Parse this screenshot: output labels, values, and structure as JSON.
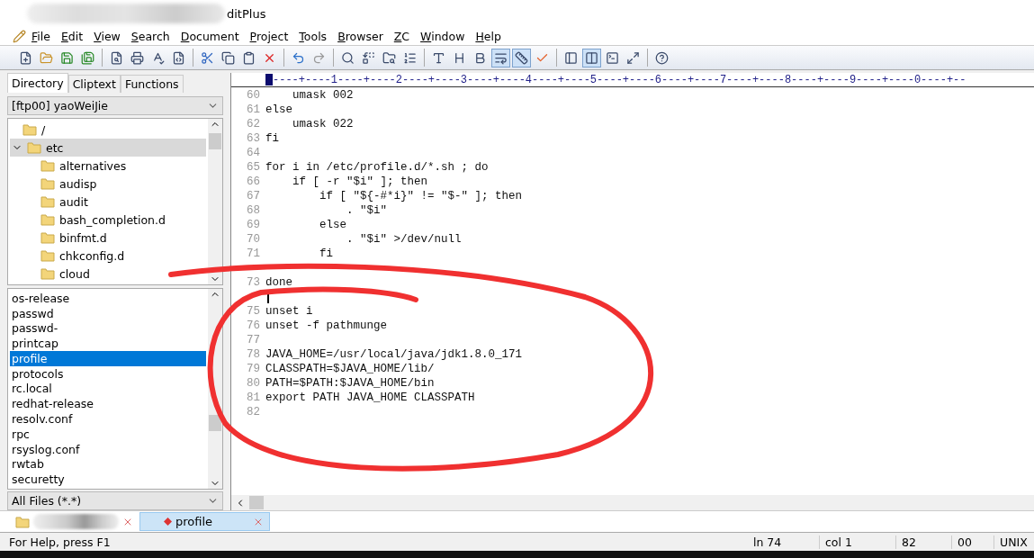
{
  "window": {
    "title": "ditPlus"
  },
  "menu": [
    {
      "label": "File"
    },
    {
      "label": "Edit"
    },
    {
      "label": "View"
    },
    {
      "label": "Search"
    },
    {
      "label": "Document"
    },
    {
      "label": "Project"
    },
    {
      "label": "Tools"
    },
    {
      "label": "Browser"
    },
    {
      "label": "ZC"
    },
    {
      "label": "Window"
    },
    {
      "label": "Help"
    }
  ],
  "toolbar": [
    {
      "kind": "new",
      "pressed": false
    },
    {
      "kind": "open",
      "pressed": false
    },
    {
      "kind": "save",
      "pressed": false
    },
    {
      "kind": "saveall",
      "pressed": false
    },
    {
      "kind": "sep"
    },
    {
      "kind": "preview",
      "pressed": false
    },
    {
      "kind": "print",
      "pressed": false
    },
    {
      "kind": "spell",
      "pressed": false
    },
    {
      "kind": "html",
      "pressed": false
    },
    {
      "kind": "sep"
    },
    {
      "kind": "cut",
      "pressed": false
    },
    {
      "kind": "copy",
      "pressed": false
    },
    {
      "kind": "paste",
      "pressed": false
    },
    {
      "kind": "delete",
      "pressed": false
    },
    {
      "kind": "sep"
    },
    {
      "kind": "undo",
      "pressed": false
    },
    {
      "kind": "redo",
      "pressed": false
    },
    {
      "kind": "sep"
    },
    {
      "kind": "find",
      "pressed": false
    },
    {
      "kind": "replace",
      "pressed": false
    },
    {
      "kind": "findfiles",
      "pressed": false
    },
    {
      "kind": "goto",
      "pressed": false
    },
    {
      "kind": "sep"
    },
    {
      "kind": "font",
      "pressed": false
    },
    {
      "kind": "heading",
      "pressed": false
    },
    {
      "kind": "bold",
      "pressed": false
    },
    {
      "kind": "wrap",
      "pressed": true
    },
    {
      "kind": "ruler",
      "pressed": true
    },
    {
      "kind": "check",
      "pressed": false
    },
    {
      "kind": "sep"
    },
    {
      "kind": "panel",
      "pressed": false
    },
    {
      "kind": "split",
      "pressed": true
    },
    {
      "kind": "output",
      "pressed": false
    },
    {
      "kind": "fullscreen",
      "pressed": false
    },
    {
      "kind": "sep"
    },
    {
      "kind": "help",
      "pressed": false
    }
  ],
  "side_tabs": [
    {
      "label": "Directory",
      "selected": true
    },
    {
      "label": "Cliptext",
      "selected": false
    },
    {
      "label": "Functions",
      "selected": false
    }
  ],
  "location": {
    "value": "[ftp00] yaoWeiJie"
  },
  "tree": [
    {
      "label": "/",
      "selected": false
    },
    {
      "label": "etc",
      "selected": true,
      "expanded": true,
      "children": [
        {
          "label": "alternatives",
          "selected": false
        },
        {
          "label": "audisp",
          "selected": false
        },
        {
          "label": "audit",
          "selected": false
        },
        {
          "label": "bash_completion.d",
          "selected": false
        },
        {
          "label": "binfmt.d",
          "selected": false
        },
        {
          "label": "chkconfig.d",
          "selected": false
        },
        {
          "label": "cloud",
          "selected": false
        }
      ]
    }
  ],
  "files": [
    {
      "label": "os-release",
      "selected": false
    },
    {
      "label": "passwd",
      "selected": false
    },
    {
      "label": "passwd-",
      "selected": false
    },
    {
      "label": "printcap",
      "selected": false
    },
    {
      "label": "profile",
      "selected": true
    },
    {
      "label": "protocols",
      "selected": false
    },
    {
      "label": "rc.local",
      "selected": false
    },
    {
      "label": "redhat-release",
      "selected": false
    },
    {
      "label": "resolv.conf",
      "selected": false
    },
    {
      "label": "rpc",
      "selected": false
    },
    {
      "label": "rsyslog.conf",
      "selected": false
    },
    {
      "label": "rwtab",
      "selected": false
    },
    {
      "label": "securetty",
      "selected": false
    }
  ],
  "filter": {
    "value": "All Files (*.*)"
  },
  "ruler": "----+----1----+----2----+----3----+----4----+----5----+----6----+----7----+----8----+----9----+----0----+--",
  "lines": [
    {
      "number": "60",
      "code": "    umask 002"
    },
    {
      "number": "61",
      "code": "else"
    },
    {
      "number": "62",
      "code": "    umask 022"
    },
    {
      "number": "63",
      "code": "fi"
    },
    {
      "number": "64"
    },
    {
      "number": "65",
      "code": "for i in /etc/profile.d/*.sh ; do"
    },
    {
      "number": "66",
      "code": "    if [ -r \"$i\" ]; then"
    },
    {
      "number": "67",
      "code": "        if [ \"${-#*i}\" != \"$-\" ]; then"
    },
    {
      "number": "68",
      "code": "            . \"$i\""
    },
    {
      "number": "69",
      "code": "        else"
    },
    {
      "number": "70",
      "code": "            . \"$i\" >/dev/null"
    },
    {
      "number": "71",
      "code": "        fi"
    },
    {
      "covered": true
    },
    {
      "number": "73",
      "code": "done"
    },
    {
      "covered": true,
      "caret": true
    },
    {
      "number": "75",
      "code": "unset i"
    },
    {
      "number": "76",
      "code": "unset -f pathmunge"
    },
    {
      "number": "77"
    },
    {
      "number": "78",
      "code": "JAVA_HOME=/usr/local/java/jdk1.8.0_171"
    },
    {
      "number": "79",
      "code": "CLASSPATH=$JAVA_HOME/lib/"
    },
    {
      "number": "80",
      "code": "PATH=$PATH:$JAVA_HOME/bin"
    },
    {
      "number": "81",
      "code": "export PATH JAVA_HOME CLASSPATH"
    },
    {
      "number": "82"
    }
  ],
  "doc_tabs": [
    {
      "kind": "redacted",
      "selected": false
    },
    {
      "kind": "file",
      "label": "profile",
      "selected": true
    }
  ],
  "status_bar": {
    "help": "For Help, press F1",
    "line": "ln 74",
    "column": "col 1",
    "total": "82",
    "code": "00",
    "format": "UNIX"
  }
}
